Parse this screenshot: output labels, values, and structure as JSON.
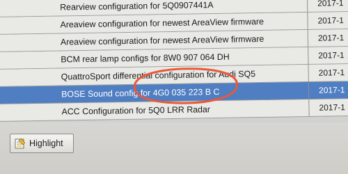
{
  "table": {
    "rows": [
      {
        "description": "Rearview configuration for 5Q0907441A",
        "date": "2017-1",
        "selected": false
      },
      {
        "description": "Areaview configuration for newest AreaView firmware",
        "date": "2017-1",
        "selected": false
      },
      {
        "description": "Areaview configuration for newest AreaView firmware",
        "date": "2017-1",
        "selected": false
      },
      {
        "description": "BCM rear lamp configs for 8W0 907 064 DH",
        "date": "2017-1",
        "selected": false
      },
      {
        "description": "QuattroSport differential configuration for Audi SQ5",
        "date": "2017-1",
        "selected": false
      },
      {
        "description": "BOSE Sound config for 4G0 035 223 B C",
        "date": "2017-1",
        "selected": true
      },
      {
        "description": "ACC Configuration for 5Q0 LRR Radar",
        "date": "2017-1",
        "selected": false
      }
    ]
  },
  "toolbar": {
    "highlight_label": "Highlight",
    "highlight_icon": "highlight-icon"
  },
  "annotation": {
    "color": "#e8593a"
  },
  "colors": {
    "selected_row": "#4f7ec2",
    "row_bg": "#e9e9e6"
  }
}
